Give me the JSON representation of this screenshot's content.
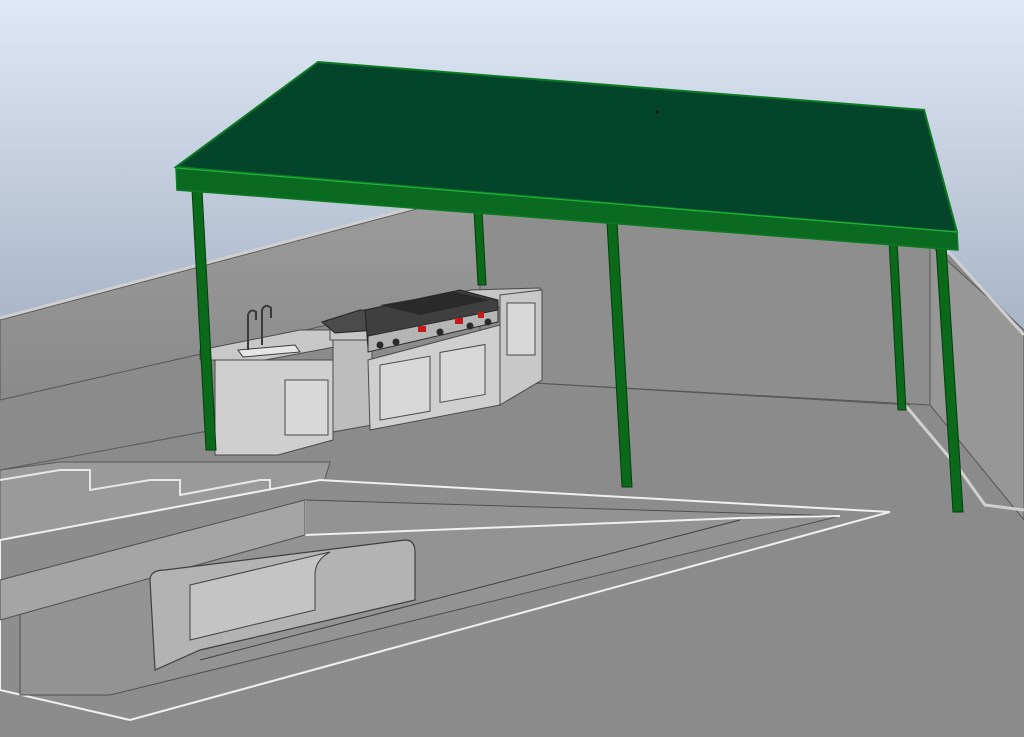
{
  "scene": {
    "view": "3d-cad-perspective",
    "description_visible_text": "",
    "colors": {
      "sky_top": "#d8e2f2",
      "sky_bottom": "#aab6c9",
      "ground": "#8b8b8b",
      "wall": "#8f8f8f",
      "wall_top": "#b9b9b9",
      "canopy_top": "#03452a",
      "canopy_edge": "#0c7a22",
      "post": "#0b6a1a",
      "cabinet": "#d2d2d2",
      "cabinet_shadow": "#a9a9a9",
      "grill_metal": "#5a5a5a",
      "burner_accent": "#c21a1a",
      "pool_line": "#f0f0f0"
    }
  }
}
